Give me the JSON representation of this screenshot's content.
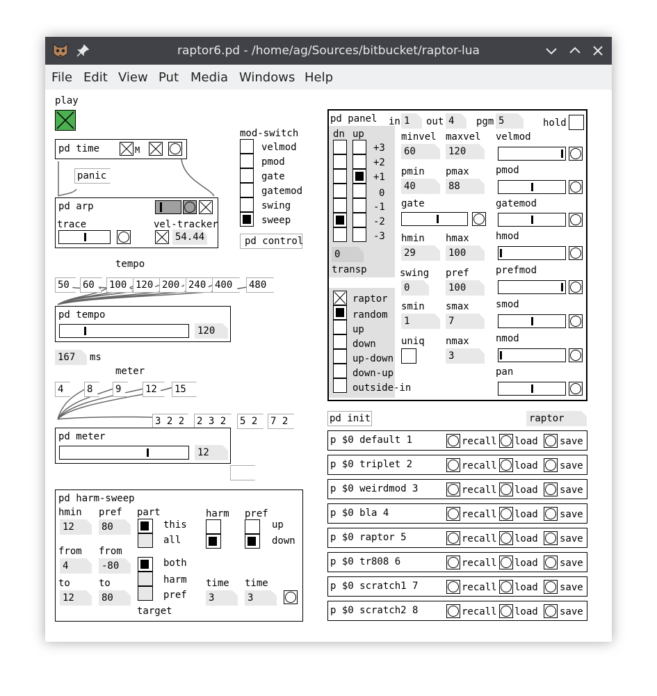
{
  "window": {
    "title": "raptor6.pd - /home/ag/Sources/bitbucket/raptor-lua",
    "menu": [
      "File",
      "Edit",
      "View",
      "Put",
      "Media",
      "Windows",
      "Help"
    ]
  },
  "play": {
    "label": "play"
  },
  "mod_switch": {
    "title": "mod-switch",
    "items": [
      "velmod",
      "pmod",
      "gate",
      "gatemod",
      "swing",
      "sweep"
    ],
    "selected": "sweep",
    "control": "pd control"
  },
  "pd_time": {
    "label": "pd time",
    "m": "M"
  },
  "panic": "panic",
  "pd_arp": {
    "label": "pd arp",
    "trace": "trace",
    "vel_tracker": "vel-tracker",
    "vel_value": "54.44"
  },
  "tempo": {
    "label": "tempo",
    "presets": [
      "50",
      "60",
      "100",
      "120",
      "200",
      "240",
      "400",
      "480"
    ],
    "box": "pd tempo",
    "value": "120",
    "ms_value": "167",
    "ms_label": "ms"
  },
  "meter": {
    "label": "meter",
    "presets": [
      "4",
      "8",
      "9",
      "12",
      "15"
    ],
    "patterns": [
      "3 2 2",
      "2 3 2",
      "5 2",
      "7 2"
    ],
    "box": "pd meter",
    "value": "12"
  },
  "harm_sweep": {
    "title": "pd harm-sweep",
    "hmin_label": "hmin",
    "hmin": "12",
    "pref_label": "pref",
    "pref": "80",
    "part_label": "part",
    "part_options": [
      "this",
      "all"
    ],
    "harm_label": "harm",
    "pref2_label": "pref",
    "dir_options": [
      "up",
      "down"
    ],
    "from_label1": "from",
    "from1": "4",
    "from_label2": "from",
    "from2": "-80",
    "target_options": [
      "both",
      "harm",
      "pref"
    ],
    "target_label": "target",
    "to_label1": "to",
    "to1": "12",
    "to_label2": "to",
    "to2": "80",
    "time_label1": "time",
    "time1": "3",
    "time_label2": "time",
    "time2": "3"
  },
  "panel": {
    "title": "pd panel",
    "in_label": "in",
    "in": "1",
    "out_label": "out",
    "out": "4",
    "pgm_label": "pgm",
    "pgm": "5",
    "hold_label": "hold",
    "dn_label": "dn",
    "up_label": "up",
    "octaves": [
      "+3",
      "+2",
      "+1",
      "0",
      "-1",
      "-2",
      "-3"
    ],
    "transp_value": "0",
    "transp_label": "transp",
    "modes": [
      "raptor",
      "random",
      "up",
      "down",
      "up-down",
      "down-up",
      "outside-in"
    ],
    "minvel_label": "minvel",
    "minvel": "60",
    "maxvel_label": "maxvel",
    "maxvel": "120",
    "velmod_label": "velmod",
    "pmin_label": "pmin",
    "pmin": "40",
    "pmax_label": "pmax",
    "pmax": "88",
    "pmod_label": "pmod",
    "gate_label": "gate",
    "gatemod_label": "gatemod",
    "hmin_label": "hmin",
    "hmin": "29",
    "hmax_label": "hmax",
    "hmax": "100",
    "hmod_label": "hmod",
    "swing_label": "swing",
    "swing": "0",
    "pref_label": "pref",
    "pref": "100",
    "prefmod_label": "prefmod",
    "smin_label": "smin",
    "smin": "1",
    "smax_label": "smax",
    "smax": "7",
    "smod_label": "smod",
    "uniq_label": "uniq",
    "nmax_label": "nmax",
    "nmax": "3",
    "nmod_label": "nmod",
    "pan_label": "pan"
  },
  "init": {
    "label": "pd init",
    "preset_name": "raptor"
  },
  "presets": {
    "recall": "recall",
    "load": "load",
    "save": "save",
    "rows": [
      "p $0 default 1",
      "p $0 triplet 2",
      "p $0 weirdmod 3",
      "p $0 bla 4",
      "p $0 raptor 5",
      "p $0 tr808 6",
      "p $0 scratch1 7",
      "p $0 scratch2 8"
    ]
  }
}
